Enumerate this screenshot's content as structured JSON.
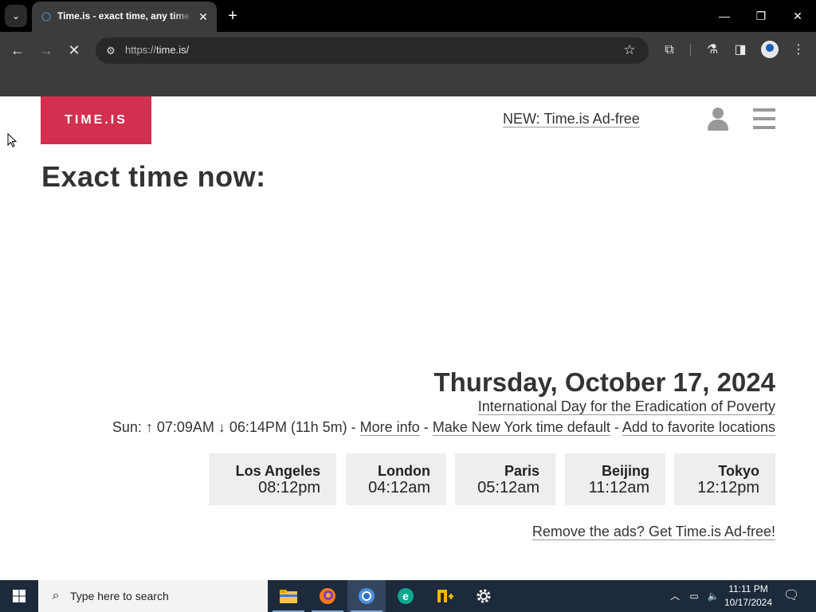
{
  "browser": {
    "tab_title": "Time.is - exact time, any time zone",
    "tab_close": "✕",
    "new_tab": "+",
    "url_scheme": "https://",
    "url_host": "time.is/",
    "window_controls": {
      "minimize": "—",
      "maximize": "❐",
      "close": "✕"
    }
  },
  "header": {
    "logo": "TIME.IS",
    "adfree_link": "NEW: Time.is Ad-free"
  },
  "main": {
    "heading": "Exact time now:",
    "date": "Thursday, October 17, 2024",
    "holiday": "International Day for the Eradication of Poverty",
    "sun": {
      "prefix": "Sun: ↑ 07:09AM ↓ 06:14PM (11h 5m) -",
      "more_info": "More info",
      "sep1": "-",
      "make_default": "Make New York time default",
      "sep2": "-",
      "add_favorite": "Add to favorite locations"
    },
    "cities": [
      {
        "name": "Los Angeles",
        "time": "08:12pm"
      },
      {
        "name": "London",
        "time": "04:12am"
      },
      {
        "name": "Paris",
        "time": "05:12am"
      },
      {
        "name": "Beijing",
        "time": "11:12am"
      },
      {
        "name": "Tokyo",
        "time": "12:12pm"
      }
    ],
    "remove_ads": "Remove the ads? Get Time.is Ad-free!"
  },
  "taskbar": {
    "search_placeholder": "Type here to search",
    "clock_time": "11:11 PM",
    "clock_date": "10/17/2024"
  },
  "colors": {
    "logo_bg": "#d32f4e",
    "taskbar_bg": "#1c2a3c",
    "browser_chrome": "#3c3c3c"
  }
}
